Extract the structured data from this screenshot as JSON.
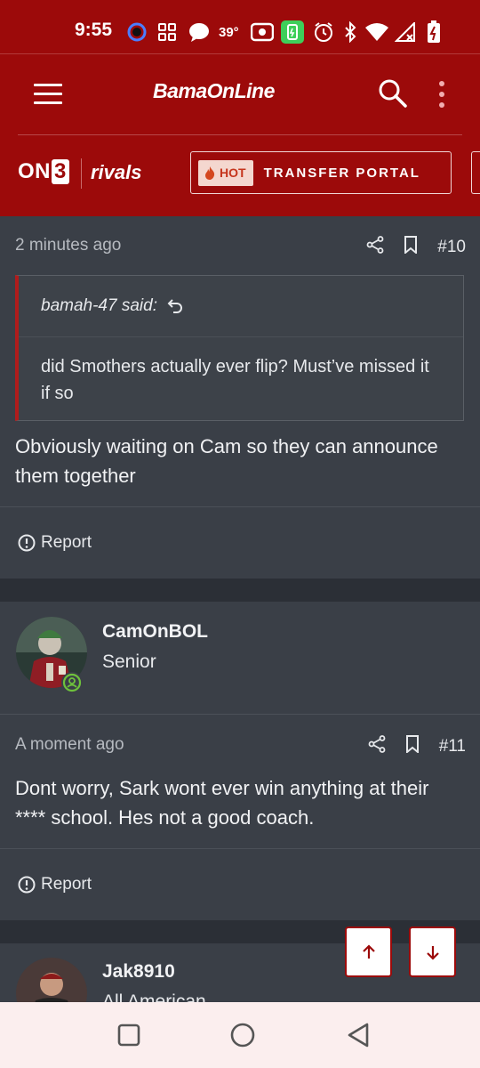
{
  "status_bar": {
    "time": "9:55",
    "temperature": "39°"
  },
  "header": {
    "site_logo": "BamaOnLine",
    "brand_on3": "ON",
    "brand_on3_digit": "3",
    "brand_rivals": "rivals",
    "hot_badge": "HOT",
    "transfer_portal": "TRANSFER PORTAL",
    "accent_color": "#9c0a0a"
  },
  "posts": [
    {
      "timestamp": "2 minutes ago",
      "post_number": "#10",
      "quote": {
        "author": "bamah-47 said:",
        "text": "did Smothers actually ever flip? Must’ve missed it if so"
      },
      "body": "Obviously waiting on Cam so they can announce them together",
      "report_label": "Report"
    },
    {
      "username": "CamOnBOL",
      "user_title": "Senior",
      "timestamp": "A moment ago",
      "post_number": "#11",
      "body": "Dont worry, Sark wont ever win anything at their **** school. Hes not a good coach.",
      "report_label": "Report"
    },
    {
      "username": "Jak8910",
      "user_title": "All American"
    }
  ]
}
